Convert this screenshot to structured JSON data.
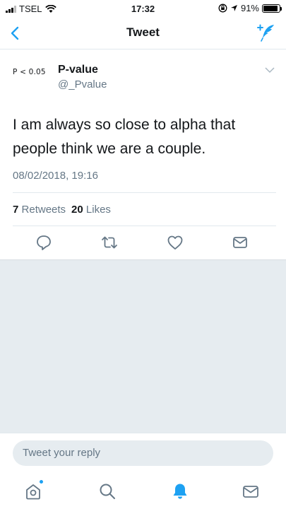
{
  "status_bar": {
    "carrier": "TSEL",
    "time": "17:32",
    "battery": "91%",
    "battery_level": 0.91
  },
  "nav": {
    "title": "Tweet"
  },
  "tweet": {
    "avatar_text": "P < 0.05",
    "display_name": "P-value",
    "handle": "@_Pvalue",
    "text": "I am always so close to alpha that people think we are a couple.",
    "timestamp": "08/02/2018, 19:16",
    "retweets_count": "7",
    "retweets_label": "Retweets",
    "likes_count": "20",
    "likes_label": "Likes"
  },
  "reply": {
    "placeholder": "Tweet your reply"
  },
  "colors": {
    "accent": "#1da1f2",
    "gray_bg": "#e6ecf0",
    "secondary_text": "#657786"
  }
}
